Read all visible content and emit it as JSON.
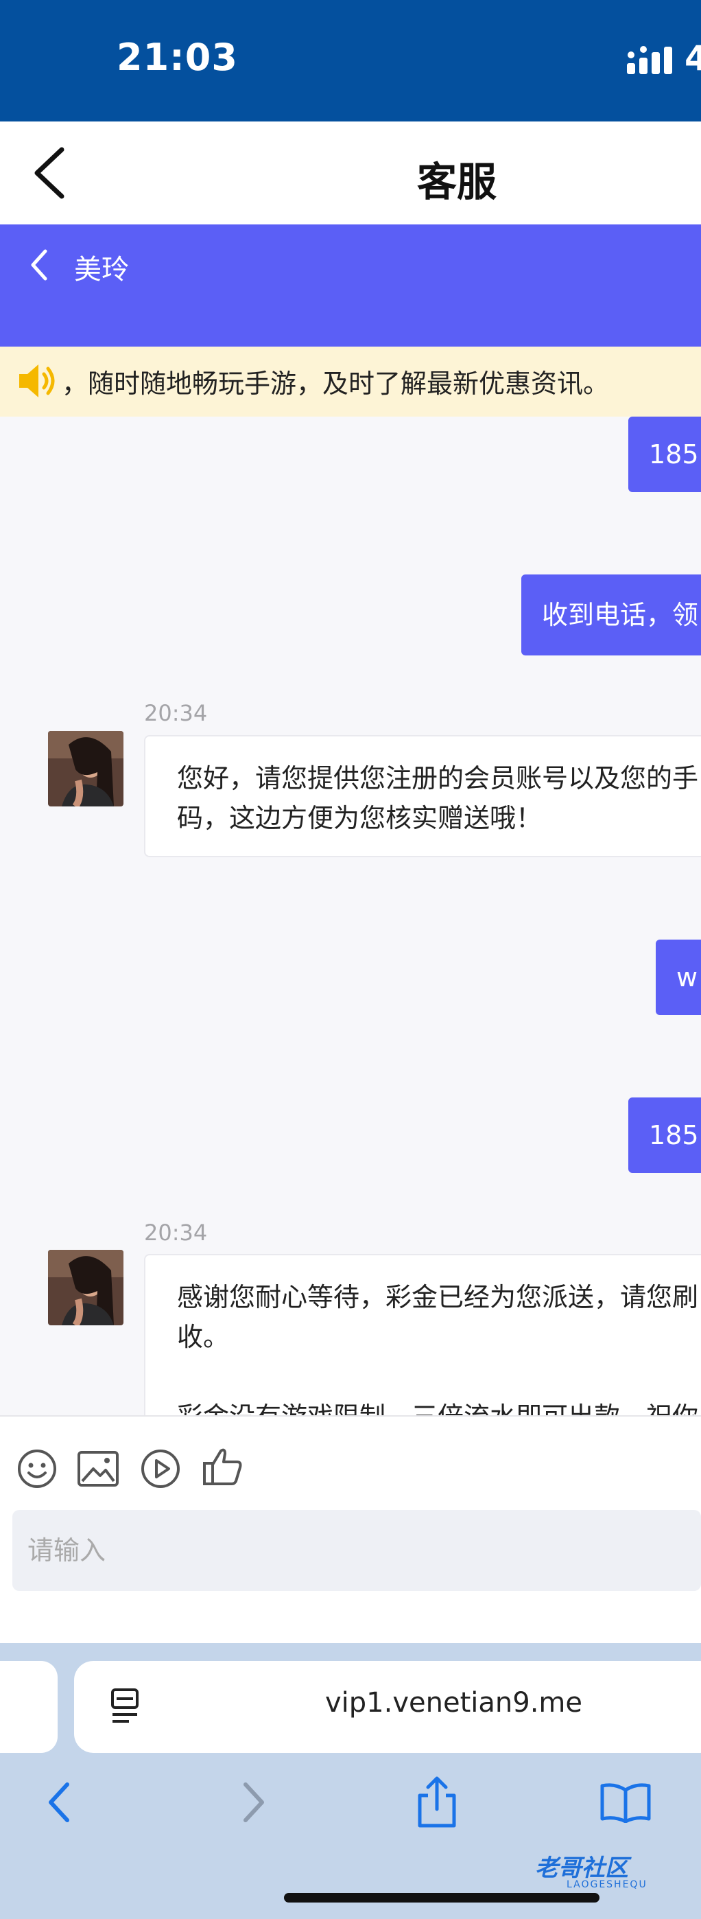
{
  "status": {
    "time": "21:03",
    "signal_label": "4"
  },
  "nav": {
    "title": "客服"
  },
  "agent": {
    "name": "美玲"
  },
  "notice": {
    "text": "，随时随地畅玩手游，及时了解最新优惠资讯。"
  },
  "messages": [
    {
      "dir": "out",
      "text": "185"
    },
    {
      "dir": "out",
      "text": "收到电话，领"
    },
    {
      "dir": "in",
      "time": "20:34",
      "lines": [
        "您好，请您提供您注册的会员账号以及您的手",
        "码，这边方便为您核实赠送哦！"
      ]
    },
    {
      "dir": "out",
      "text": "w"
    },
    {
      "dir": "out",
      "text": "185"
    },
    {
      "dir": "in",
      "time": "20:34",
      "lines": [
        "感谢您耐心等待，彩金已经为您派送，请您刷",
        "收。",
        "",
        "彩金没有游戏限制，三倍流水即可出款，祝你"
      ]
    }
  ],
  "toolbar": {
    "icons": [
      "emoji-icon",
      "image-icon",
      "video-icon",
      "thumbs-up-icon"
    ]
  },
  "input": {
    "placeholder": "请输入"
  },
  "browser": {
    "url": "vip1.venetian9.me"
  },
  "watermark": {
    "text": "老哥社区",
    "sub": "LAOGESHEQU"
  },
  "colors": {
    "status_bg": "#04509e",
    "accent": "#5b5ff6",
    "notice_bg": "#fdf4d6",
    "browser_bg": "#c4d5ea"
  }
}
